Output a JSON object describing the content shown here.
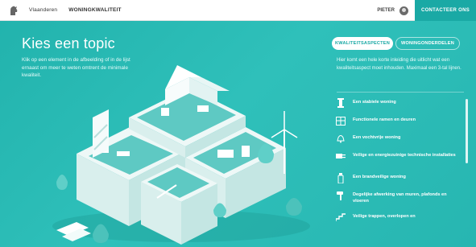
{
  "header": {
    "crumbs": [
      "Vlaanderen",
      "WONINGKWALITEIT"
    ],
    "user": "PIETER",
    "contact": "CONTACTEER ONS"
  },
  "main": {
    "title": "Kies een topic",
    "intro": "Klik op een element in de afbeelding of in de lijst ernaast om meer te weten omtrent de minimale kwaliteit."
  },
  "panel": {
    "tabs": [
      "KWALITEITSASPECTEN",
      "WONINGONDERDELEN"
    ],
    "text": "Hier komt een hele korte inleiding die uitlicht wat een kwaliteitsaspect moet inhouden. Maximaal een 3-tal lijnen.",
    "items": [
      {
        "icon": "pillar-icon",
        "label": "Een stabiele woning"
      },
      {
        "icon": "window-icon",
        "label": "Functionele ramen en deuren"
      },
      {
        "icon": "bell-icon",
        "label": "Een vochtvrije woning"
      },
      {
        "icon": "plug-icon",
        "label": "Veilige en energiezuinige technische installaties"
      },
      {
        "icon": "extinguisher-icon",
        "label": "Een brandveilige woning"
      },
      {
        "icon": "hammer-icon",
        "label": "Degelijke afwerking van muren, plafonds en vloeren"
      },
      {
        "icon": "stairs-icon",
        "label": "Veilige trappen, overlopen en"
      }
    ]
  },
  "colors": {
    "accent": "#1aa9a5",
    "stage": "#2ab8b2"
  }
}
